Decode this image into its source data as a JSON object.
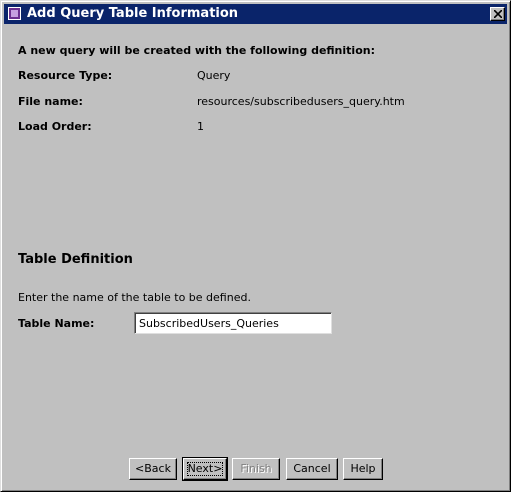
{
  "window": {
    "title": "Add Query Table Information",
    "close_icon": "close-icon"
  },
  "summary": {
    "intro": "A new query will be created with the following definition:",
    "rows": [
      {
        "label": "Resource Type:",
        "value": "Query"
      },
      {
        "label": "File name:",
        "value": "resources/subscribedusers_query.htm"
      },
      {
        "label": "Load Order:",
        "value": "1"
      }
    ]
  },
  "table_definition": {
    "heading": "Table Definition",
    "instruction": "Enter the name of the table to be defined.",
    "table_name_label": "Table Name:",
    "table_name_value": "SubscribedUsers_Queries"
  },
  "buttons": {
    "back": "<Back",
    "next": "Next>",
    "finish": "Finish",
    "cancel": "Cancel",
    "help": "Help"
  },
  "colors": {
    "titlebar": "#0a246a",
    "dialog_bg": "#c0c0c0",
    "disabled_text": "#808080"
  }
}
